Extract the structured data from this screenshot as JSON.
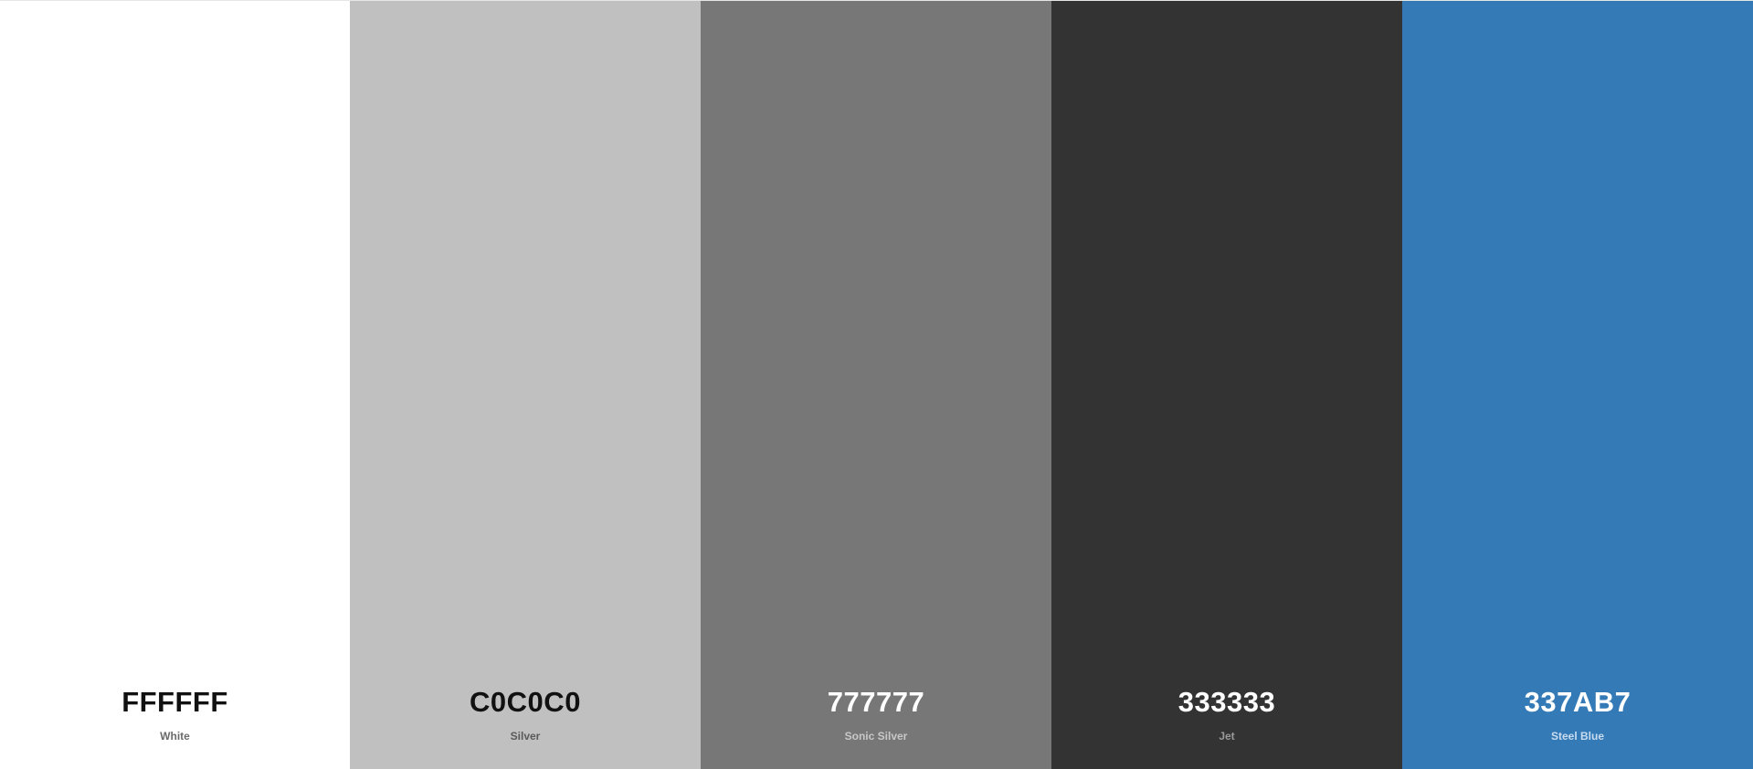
{
  "palette": {
    "swatches": [
      {
        "hex": "FFFFFF",
        "name": "White",
        "bg": "#FFFFFF",
        "hex_color": "#111111",
        "name_color": "#6b6b6b"
      },
      {
        "hex": "C0C0C0",
        "name": "Silver",
        "bg": "#C0C0C0",
        "hex_color": "#111111",
        "name_color": "#5a5a5a"
      },
      {
        "hex": "777777",
        "name": "Sonic Silver",
        "bg": "#777777",
        "hex_color": "#ffffff",
        "name_color": "#c8c8c8"
      },
      {
        "hex": "333333",
        "name": "Jet",
        "bg": "#333333",
        "hex_color": "#ffffff",
        "name_color": "#9a9a9a"
      },
      {
        "hex": "337AB7",
        "name": "Steel Blue",
        "bg": "#337AB7",
        "hex_color": "#ffffff",
        "name_color": "#c9dcef"
      }
    ]
  }
}
